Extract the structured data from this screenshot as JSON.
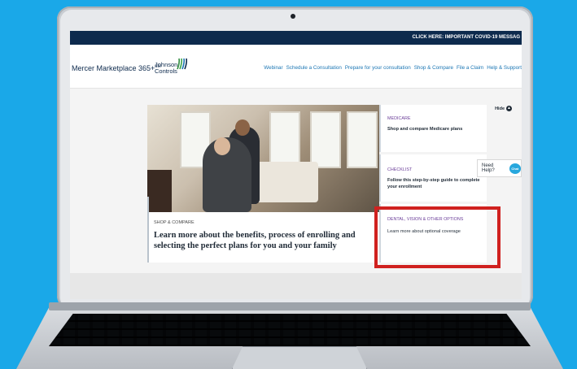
{
  "covid_bar": {
    "text": "CLICK HERE:  IMPORTANT COVID-19 MESSAG"
  },
  "header": {
    "brand": "Mercer Marketplace 365+",
    "brand_mark": "SM",
    "partner_logo_text": "Johnson Controls",
    "nav": [
      "Webinar",
      "Schedule a Consultation",
      "Prepare for your consultation",
      "Shop & Compare",
      "File a Claim",
      "Help & Support"
    ]
  },
  "hero": {
    "eyebrow": "SHOP & COMPARE",
    "title": "Learn more about the benefits, process of enrolling and selecting the perfect plans for you and your family"
  },
  "side_cards": {
    "medicare": {
      "label": "MEDICARE",
      "text": "Shop and compare Medicare plans"
    },
    "checklist": {
      "label": "CHECKLIST",
      "text": "Follow this step-by-step guide to complete your enrollment"
    },
    "dental": {
      "label": "DENTAL, VISION & OTHER OPTIONS",
      "text": "Learn more about optional coverage"
    }
  },
  "hide_label": "Hide",
  "help": {
    "label": "Need Help?",
    "bubble": "Chat"
  },
  "colors": {
    "background": "#1aa8e8",
    "navy": "#0d2a4d",
    "link": "#1b76b4",
    "highlight": "#d0211f",
    "label_purple": "#6b3e99"
  }
}
